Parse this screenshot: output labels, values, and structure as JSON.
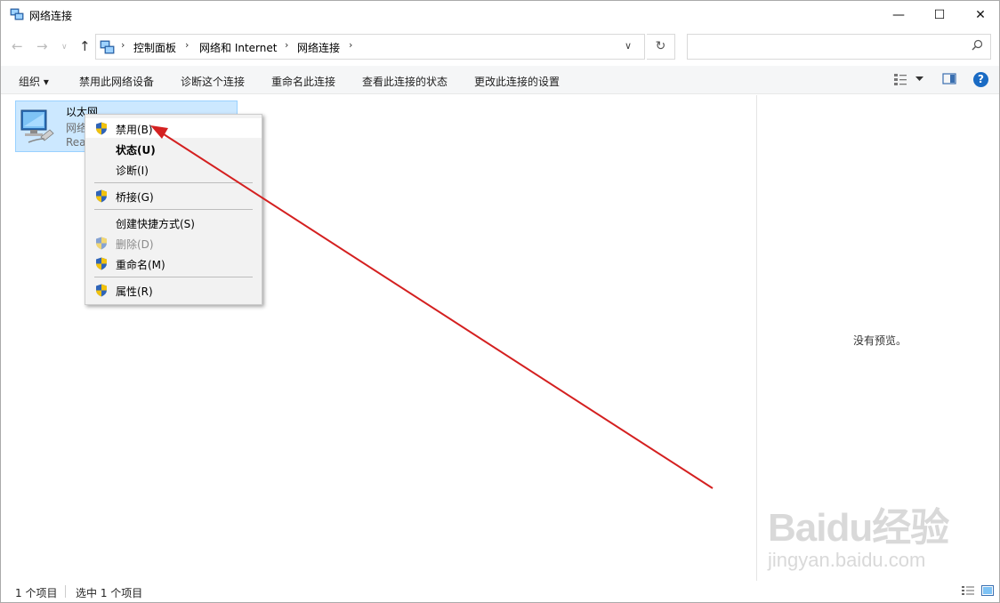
{
  "window": {
    "title": "网络连接",
    "minimize": "—",
    "maximize": "☐",
    "close": "✕"
  },
  "nav": {
    "back": "←",
    "forward": "→",
    "recent": "∨",
    "up": "↑",
    "breadcrumb": [
      "控制面板",
      "网络和 Internet",
      "网络连接"
    ],
    "separator": "›",
    "dropdown": "∨",
    "refresh": "↻",
    "search_placeholder": ""
  },
  "toolbar": {
    "organize": "组织 ▾",
    "commands": [
      "禁用此网络设备",
      "诊断这个连接",
      "重命名此连接",
      "查看此连接的状态",
      "更改此连接的设置"
    ],
    "help": "?"
  },
  "item": {
    "name": "以太网",
    "line1": "网络",
    "line2": "Rea"
  },
  "context_menu": [
    {
      "label": "禁用(B)",
      "shield": true,
      "bold": false,
      "disabled": false
    },
    {
      "label": "状态(U)",
      "shield": false,
      "bold": true,
      "disabled": false
    },
    {
      "label": "诊断(I)",
      "shield": false,
      "bold": false,
      "disabled": false
    },
    {
      "label": "桥接(G)",
      "shield": true,
      "bold": false,
      "disabled": false
    },
    {
      "label": "创建快捷方式(S)",
      "shield": false,
      "bold": false,
      "disabled": false
    },
    {
      "label": "删除(D)",
      "shield": true,
      "bold": false,
      "disabled": true
    },
    {
      "label": "重命名(M)",
      "shield": true,
      "bold": false,
      "disabled": false
    },
    {
      "label": "属性(R)",
      "shield": true,
      "bold": false,
      "disabled": false
    }
  ],
  "preview": {
    "empty_text": "没有预览。"
  },
  "status": {
    "item_count": "1 个项目",
    "selected_count": "选中 1 个项目"
  },
  "watermark": {
    "logo": "Baidu经验",
    "url": "jingyan.baidu.com"
  },
  "colors": {
    "selection_bg": "#cce8ff",
    "selection_border": "#99d1ff",
    "annotation_arrow": "#d42020",
    "shield_blue": "#2f64b8",
    "shield_yellow": "#f2c20c"
  }
}
